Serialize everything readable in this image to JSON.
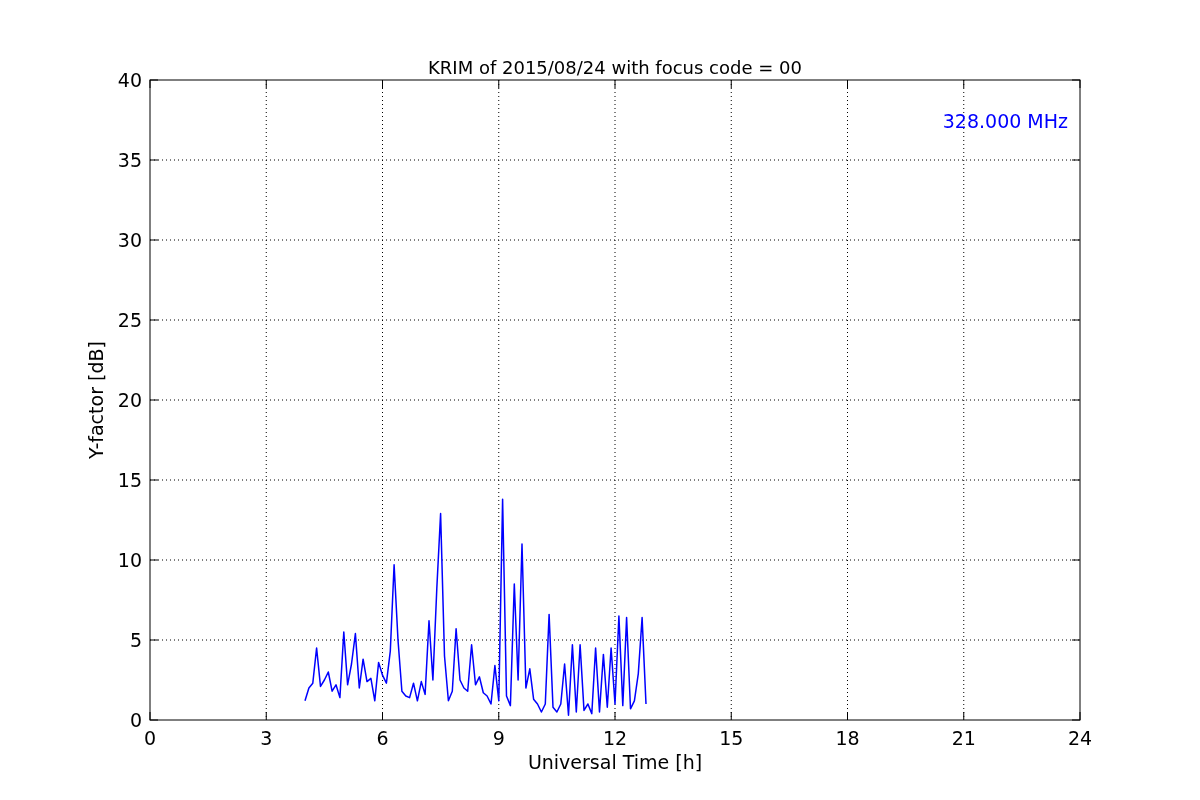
{
  "chart_data": {
    "type": "line",
    "title": "KRIM of 2015/08/24 with focus code = 00",
    "xlabel": "Universal Time [h]",
    "ylabel": "Y-factor [dB]",
    "x": [
      4.0,
      4.1,
      4.2,
      4.3,
      4.4,
      4.5,
      4.6,
      4.7,
      4.8,
      4.9,
      5.0,
      5.1,
      5.2,
      5.3,
      5.4,
      5.5,
      5.6,
      5.7,
      5.8,
      5.9,
      6.0,
      6.1,
      6.2,
      6.3,
      6.4,
      6.5,
      6.6,
      6.7,
      6.8,
      6.9,
      7.0,
      7.1,
      7.2,
      7.3,
      7.4,
      7.5,
      7.6,
      7.7,
      7.8,
      7.9,
      8.0,
      8.1,
      8.2,
      8.3,
      8.4,
      8.5,
      8.6,
      8.7,
      8.8,
      8.9,
      9.0,
      9.1,
      9.2,
      9.3,
      9.4,
      9.5,
      9.6,
      9.7,
      9.8,
      9.9,
      10.0,
      10.1,
      10.2,
      10.3,
      10.4,
      10.5,
      10.6,
      10.7,
      10.8,
      10.9,
      11.0,
      11.1,
      11.2,
      11.3,
      11.4,
      11.5,
      11.6,
      11.7,
      11.8,
      11.9,
      12.0,
      12.1,
      12.2,
      12.3,
      12.4,
      12.5,
      12.6,
      12.7,
      12.8
    ],
    "series": [
      {
        "name": "328.000 MHz",
        "color": "#0000ff",
        "values": [
          1.2,
          2.0,
          2.3,
          4.5,
          2.1,
          2.5,
          3.0,
          1.8,
          2.2,
          1.4,
          5.5,
          2.2,
          3.5,
          5.4,
          2.0,
          3.8,
          2.4,
          2.6,
          1.2,
          3.6,
          2.8,
          2.3,
          4.3,
          9.7,
          5.0,
          1.8,
          1.5,
          1.4,
          2.3,
          1.2,
          2.4,
          1.6,
          6.2,
          2.5,
          8.2,
          12.9,
          4.0,
          1.2,
          1.8,
          5.7,
          2.5,
          2.0,
          1.8,
          4.7,
          2.2,
          2.7,
          1.7,
          1.5,
          1.0,
          3.4,
          1.2,
          13.8,
          1.5,
          0.9,
          8.5,
          2.5,
          11.0,
          2.0,
          3.2,
          1.3,
          1.0,
          0.5,
          1.0,
          6.6,
          0.8,
          0.5,
          1.0,
          3.5,
          0.3,
          4.7,
          0.5,
          4.7,
          0.6,
          1.0,
          0.4,
          4.5,
          0.5,
          4.1,
          0.8,
          4.5,
          1.0,
          6.5,
          0.9,
          6.4,
          0.7,
          1.2,
          2.9,
          6.4,
          1.0
        ]
      }
    ],
    "xlim": [
      0,
      24
    ],
    "ylim": [
      0,
      40
    ],
    "xticks": [
      0,
      3,
      6,
      9,
      12,
      15,
      18,
      21,
      24
    ],
    "yticks": [
      0,
      5,
      10,
      15,
      20,
      25,
      30,
      35,
      40
    ],
    "grid": true
  }
}
